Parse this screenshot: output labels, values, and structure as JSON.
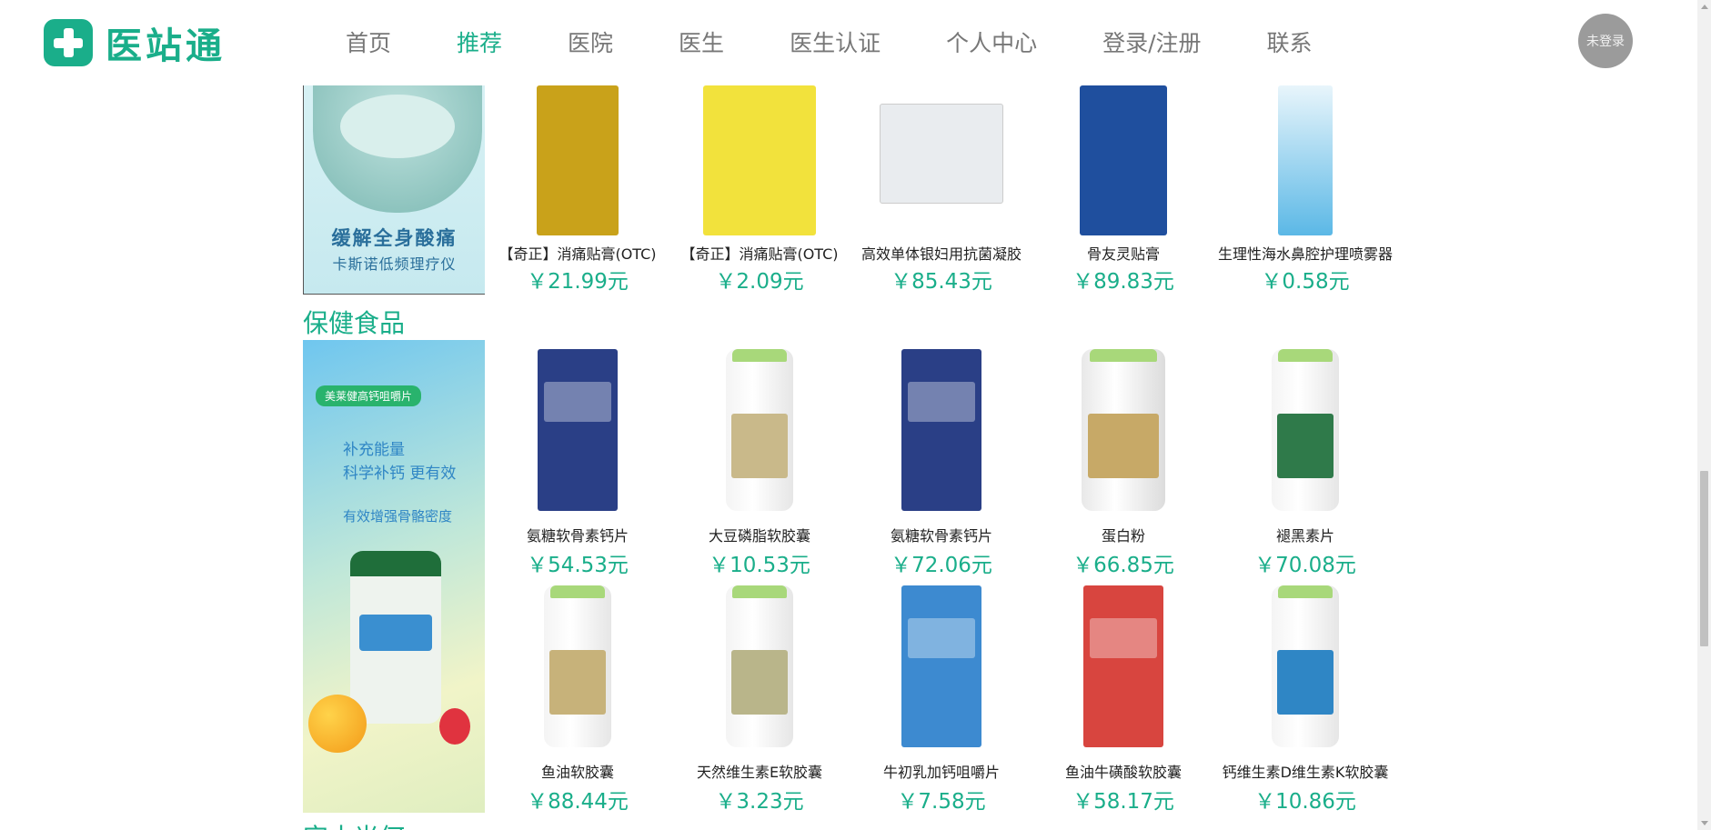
{
  "header": {
    "logo_text": "医站通",
    "nav": [
      "首页",
      "推荐",
      "医院",
      "医生",
      "医生认证",
      "个人中心",
      "登录/注册",
      "联系"
    ],
    "active_nav": "推荐",
    "avatar_label": "未登录"
  },
  "banners": {
    "device": {
      "line1": "缓解全身酸痛",
      "line2": "卡斯诺低频理疗仪"
    },
    "health": {
      "pill": "美莱健高钙咀嚼片",
      "line1": "补充能量",
      "line2": "科学补钙 更有效",
      "line3": "有效增强骨骼密度"
    }
  },
  "sections": {
    "health_title": "保健食品",
    "next_title": "完十光何"
  },
  "products_row1": [
    {
      "name": "【奇正】消痛贴膏(OTC)",
      "price": "￥21.99元",
      "color": "#c9a21a"
    },
    {
      "name": "【奇正】消痛贴膏(OTC)",
      "price": "￥2.09元",
      "color": "#f2e23c"
    },
    {
      "name": "高效单体银妇用抗菌凝胶",
      "price": "￥85.43元",
      "color": "#e9ecef"
    },
    {
      "name": "骨友灵贴膏",
      "price": "￥89.83元",
      "color": "#1f4f9e"
    },
    {
      "name": "生理性海水鼻腔护理喷雾器",
      "price": "￥0.58元",
      "color": "#5bb8e6"
    }
  ],
  "products_row2": [
    {
      "name": "氨糖软骨素钙片",
      "price": "￥54.53元",
      "color": "#2a3f86"
    },
    {
      "name": "大豆磷脂软胶囊",
      "price": "￥10.53元",
      "color": "#c9b98a"
    },
    {
      "name": "氨糖软骨素钙片",
      "price": "￥72.06元",
      "color": "#2a3f86"
    },
    {
      "name": "蛋白粉",
      "price": "￥66.85元",
      "color": "#c7a967"
    },
    {
      "name": "褪黑素片",
      "price": "￥70.08元",
      "color": "#2f7a4a"
    }
  ],
  "products_row3": [
    {
      "name": "鱼油软胶囊",
      "price": "￥88.44元",
      "color": "#c7b27a"
    },
    {
      "name": "天然维生素E软胶囊",
      "price": "￥3.23元",
      "color": "#b9b58a"
    },
    {
      "name": "牛初乳加钙咀嚼片",
      "price": "￥7.58元",
      "color": "#3d8ad0"
    },
    {
      "name": "鱼油牛磺酸软胶囊",
      "price": "￥58.17元",
      "color": "#d8453f"
    },
    {
      "name": "钙维生素D维生素K软胶囊",
      "price": "￥10.86元",
      "color": "#2f86c5"
    }
  ]
}
